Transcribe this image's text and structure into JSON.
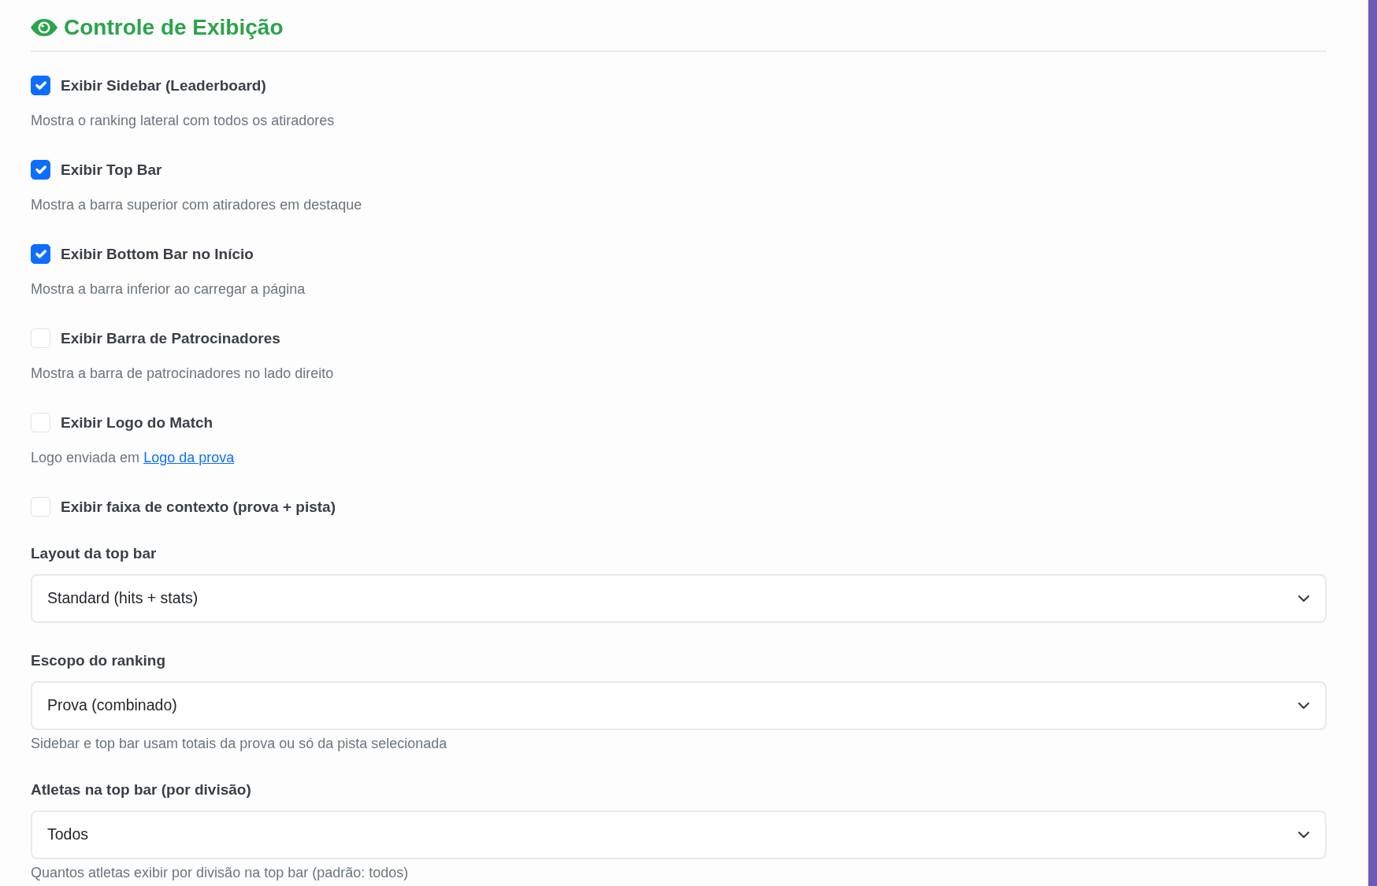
{
  "section": {
    "title": "Controle de Exibição"
  },
  "display_options": [
    {
      "label": "Exibir Sidebar (Leaderboard)",
      "checked": true,
      "description": "Mostra o ranking lateral com todos os atiradores"
    },
    {
      "label": "Exibir Top Bar",
      "checked": true,
      "description": "Mostra a barra superior com atiradores em destaque"
    },
    {
      "label": "Exibir Bottom Bar no Início",
      "checked": true,
      "description": "Mostra a barra inferior ao carregar a página"
    },
    {
      "label": "Exibir Barra de Patrocinadores",
      "checked": false,
      "description": "Mostra a barra de patrocinadores no lado direito"
    },
    {
      "label": "Exibir Logo do Match",
      "checked": false,
      "description": "Logo enviada em",
      "description_link": "Logo da prova"
    },
    {
      "label": "Exibir faixa de contexto (prova + pista)",
      "checked": false
    }
  ],
  "select_fields": [
    {
      "label": "Layout da top bar",
      "value": "Standard (hits + stats)"
    },
    {
      "label": "Escopo do ranking",
      "value": "Prova (combinado)",
      "hint": "Sidebar e top bar usam totais da prova ou só da pista selecionada"
    },
    {
      "label": "Atletas na top bar (por divisão)",
      "value": "Todos",
      "hint": "Quantos atletas exibir por divisão na top bar (padrão: todos)"
    }
  ]
}
